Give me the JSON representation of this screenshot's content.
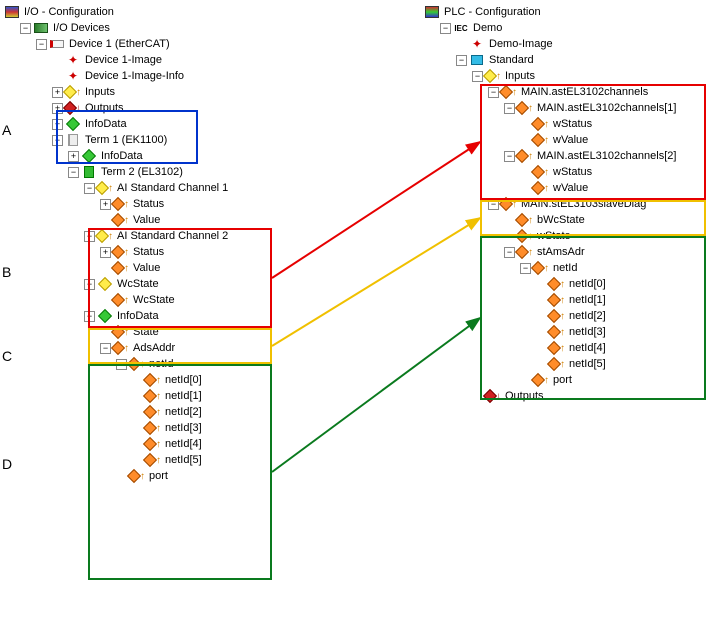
{
  "left": {
    "root": "I/O - Configuration",
    "devices": "I/O Devices",
    "dev1": "Device 1 (EtherCAT)",
    "dev1img": "Device 1-Image",
    "dev1imginfo": "Device 1-Image-Info",
    "inputs": "Inputs",
    "outputs": "Outputs",
    "infodata": "InfoData",
    "term1": "Term 1 (EK1100)",
    "term1_infodata": "InfoData",
    "term2": "Term 2 (EL3102)",
    "ch1": "AI Standard Channel 1",
    "ch1_status": "Status",
    "ch1_value": "Value",
    "ch2": "AI Standard Channel 2",
    "ch2_status": "Status",
    "ch2_value": "Value",
    "wcstate": "WcState",
    "wcstate_sub": "WcState",
    "info2": "InfoData",
    "state": "State",
    "adsaddr": "AdsAddr",
    "netid": "netId",
    "netid_items": [
      "netId[0]",
      "netId[1]",
      "netId[2]",
      "netId[3]",
      "netId[4]",
      "netId[5]"
    ],
    "port": "port"
  },
  "right": {
    "root": "PLC - Configuration",
    "demo": "Demo",
    "demoimg": "Demo-Image",
    "standard": "Standard",
    "inputs": "Inputs",
    "main_ch": "MAIN.astEL3102channels",
    "ch1": "MAIN.astEL3102channels[1]",
    "ch1_wstatus": "wStatus",
    "ch1_wvalue": "wValue",
    "ch2": "MAIN.astEL3102channels[2]",
    "ch2_wstatus": "wStatus",
    "ch2_wvalue": "wValue",
    "slave": "MAIN.stEL3103slaveDiag",
    "bwc": "bWcState",
    "wstate": "wState",
    "stams": "stAmsAdr",
    "netid": "netId",
    "netid_items": [
      "netId[0]",
      "netId[1]",
      "netId[2]",
      "netId[3]",
      "netId[4]",
      "netId[5]"
    ],
    "port": "port",
    "outputs": "Outputs"
  },
  "labels": {
    "A": "A",
    "B": "B",
    "C": "C",
    "D": "D"
  },
  "colors": {
    "blue": "#0033cc",
    "red": "#e60000",
    "yellow": "#f0c000",
    "green": "#0a7a1e"
  }
}
